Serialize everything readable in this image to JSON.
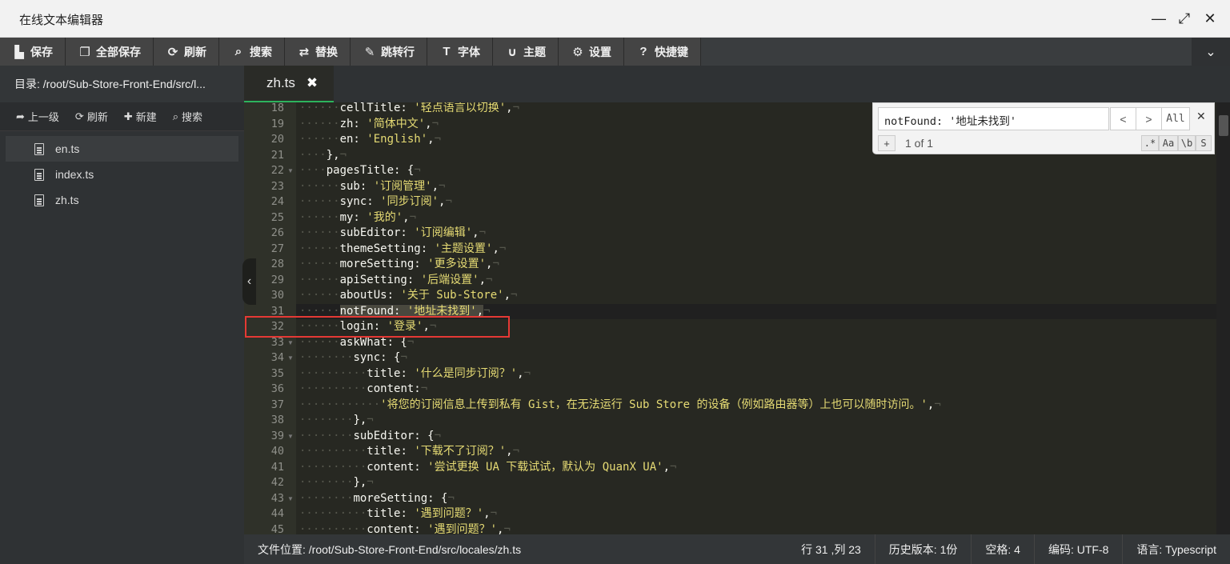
{
  "window": {
    "title": "在线文本编辑器"
  },
  "toolbar": [
    {
      "label": "保存",
      "icon": "save-icon",
      "glyph": "▙"
    },
    {
      "label": "全部保存",
      "icon": "copy-icon",
      "glyph": "❐"
    },
    {
      "label": "刷新",
      "icon": "refresh-icon",
      "glyph": "⟳"
    },
    {
      "label": "搜索",
      "icon": "search-icon",
      "glyph": "⌕"
    },
    {
      "label": "替换",
      "icon": "replace-icon",
      "glyph": "⇄"
    },
    {
      "label": "跳转行",
      "icon": "pin-icon",
      "glyph": "✎"
    },
    {
      "label": "字体",
      "icon": "font-icon",
      "glyph": "T"
    },
    {
      "label": "主题",
      "icon": "magnet-icon",
      "glyph": "∪"
    },
    {
      "label": "设置",
      "icon": "gear-icon",
      "glyph": "⚙"
    },
    {
      "label": "快捷键",
      "icon": "help-icon",
      "glyph": "?"
    }
  ],
  "sidebar": {
    "path": "目录: /root/Sub-Store-Front-End/src/l...",
    "actions": [
      {
        "label": "上一级",
        "icon": "up-arrow-icon",
        "glyph": "➦"
      },
      {
        "label": "刷新",
        "icon": "refresh-icon",
        "glyph": "⟳"
      },
      {
        "label": "新建",
        "icon": "plus-icon",
        "glyph": "✚"
      },
      {
        "label": "搜索",
        "icon": "search-icon",
        "glyph": "⌕"
      }
    ],
    "files": [
      "en.ts",
      "index.ts",
      "zh.ts"
    ]
  },
  "editor": {
    "tab": "zh.ts",
    "lines": [
      {
        "n": "18",
        "indent": 3,
        "t": [
          [
            "k",
            "cellTitle: "
          ],
          [
            "s",
            "'轻点语言以切换'"
          ],
          [
            "p",
            ","
          ]
        ]
      },
      {
        "n": "19",
        "indent": 3,
        "t": [
          [
            "k",
            "zh: "
          ],
          [
            "s",
            "'简体中文'"
          ],
          [
            "p",
            ","
          ]
        ]
      },
      {
        "n": "20",
        "indent": 3,
        "t": [
          [
            "k",
            "en: "
          ],
          [
            "s",
            "'English'"
          ],
          [
            "p",
            ","
          ]
        ]
      },
      {
        "n": "21",
        "indent": 2,
        "t": [
          [
            "p",
            "},"
          ]
        ]
      },
      {
        "n": "22",
        "indent": 2,
        "fold": true,
        "t": [
          [
            "k",
            "pagesTitle: {"
          ]
        ]
      },
      {
        "n": "23",
        "indent": 3,
        "t": [
          [
            "k",
            "sub: "
          ],
          [
            "s",
            "'订阅管理'"
          ],
          [
            "p",
            ","
          ]
        ]
      },
      {
        "n": "24",
        "indent": 3,
        "t": [
          [
            "k",
            "sync: "
          ],
          [
            "s",
            "'同步订阅'"
          ],
          [
            "p",
            ","
          ]
        ]
      },
      {
        "n": "25",
        "indent": 3,
        "t": [
          [
            "k",
            "my: "
          ],
          [
            "s",
            "'我的'"
          ],
          [
            "p",
            ","
          ]
        ]
      },
      {
        "n": "26",
        "indent": 3,
        "t": [
          [
            "k",
            "subEditor: "
          ],
          [
            "s",
            "'订阅编辑'"
          ],
          [
            "p",
            ","
          ]
        ]
      },
      {
        "n": "27",
        "indent": 3,
        "t": [
          [
            "k",
            "themeSetting: "
          ],
          [
            "s",
            "'主题设置'"
          ],
          [
            "p",
            ","
          ]
        ]
      },
      {
        "n": "28",
        "indent": 3,
        "t": [
          [
            "k",
            "moreSetting: "
          ],
          [
            "s",
            "'更多设置'"
          ],
          [
            "p",
            ","
          ]
        ]
      },
      {
        "n": "29",
        "indent": 3,
        "t": [
          [
            "k",
            "apiSetting: "
          ],
          [
            "s",
            "'后端设置'"
          ],
          [
            "p",
            ","
          ]
        ]
      },
      {
        "n": "30",
        "indent": 3,
        "t": [
          [
            "k",
            "aboutUs: "
          ],
          [
            "s",
            "'关于 Sub-Store'"
          ],
          [
            "p",
            ","
          ]
        ]
      },
      {
        "n": "31",
        "indent": 3,
        "current": true,
        "t": [
          [
            "k",
            "notFound: "
          ],
          [
            "s",
            "'地址未找到'"
          ],
          [
            "p",
            ","
          ]
        ]
      },
      {
        "n": "32",
        "indent": 3,
        "t": [
          [
            "k",
            "login: "
          ],
          [
            "s",
            "'登录'"
          ],
          [
            "p",
            ","
          ]
        ]
      },
      {
        "n": "33",
        "indent": 3,
        "fold": true,
        "t": [
          [
            "k",
            "askWhat: {"
          ]
        ]
      },
      {
        "n": "34",
        "indent": 4,
        "fold": true,
        "t": [
          [
            "k",
            "sync: {"
          ]
        ]
      },
      {
        "n": "35",
        "indent": 5,
        "t": [
          [
            "k",
            "title: "
          ],
          [
            "s",
            "'什么是同步订阅？'"
          ],
          [
            "p",
            ","
          ]
        ]
      },
      {
        "n": "36",
        "indent": 5,
        "t": [
          [
            "k",
            "content:"
          ]
        ]
      },
      {
        "n": "37",
        "indent": 6,
        "t": [
          [
            "s",
            "'将您的订阅信息上传到私有 Gist，在无法运行 Sub Store 的设备（例如路由器等）上也可以随时访问。'"
          ],
          [
            "p",
            ","
          ]
        ]
      },
      {
        "n": "38",
        "indent": 4,
        "t": [
          [
            "p",
            "},"
          ]
        ]
      },
      {
        "n": "39",
        "indent": 4,
        "fold": true,
        "t": [
          [
            "k",
            "subEditor: {"
          ]
        ]
      },
      {
        "n": "40",
        "indent": 5,
        "t": [
          [
            "k",
            "title: "
          ],
          [
            "s",
            "'下载不了订阅？'"
          ],
          [
            "p",
            ","
          ]
        ]
      },
      {
        "n": "41",
        "indent": 5,
        "t": [
          [
            "k",
            "content: "
          ],
          [
            "s",
            "'尝试更换 UA 下载试试，默认为 QuanX UA'"
          ],
          [
            "p",
            ","
          ]
        ]
      },
      {
        "n": "42",
        "indent": 4,
        "t": [
          [
            "p",
            "},"
          ]
        ]
      },
      {
        "n": "43",
        "indent": 4,
        "fold": true,
        "t": [
          [
            "k",
            "moreSetting: {"
          ]
        ]
      },
      {
        "n": "44",
        "indent": 5,
        "t": [
          [
            "k",
            "title: "
          ],
          [
            "s",
            "'遇到问题？'"
          ],
          [
            "p",
            ","
          ]
        ]
      },
      {
        "n": "45",
        "indent": 5,
        "t": [
          [
            "k",
            "content: "
          ],
          [
            "s",
            "'遇到问题？'"
          ],
          [
            "p",
            ","
          ]
        ]
      }
    ]
  },
  "search": {
    "value": "notFound: '地址未找到'",
    "prev": "<",
    "next": ">",
    "all": "All",
    "close": "✕",
    "plus": "+",
    "count": "1 of 1",
    "options": [
      ".*",
      "Aa",
      "\\b",
      "S"
    ]
  },
  "status": {
    "path": "文件位置: /root/Sub-Store-Front-End/src/locales/zh.ts",
    "position": "行 31 ,列 23",
    "history": "历史版本: 1份",
    "indent": "空格: 4",
    "encoding": "编码: UTF-8",
    "language": "语言: Typescript"
  },
  "colors": {
    "accent": "#2db35d",
    "keyword": "#f8f8f2",
    "string": "#e6db74",
    "highlight_box": "#e53935"
  }
}
